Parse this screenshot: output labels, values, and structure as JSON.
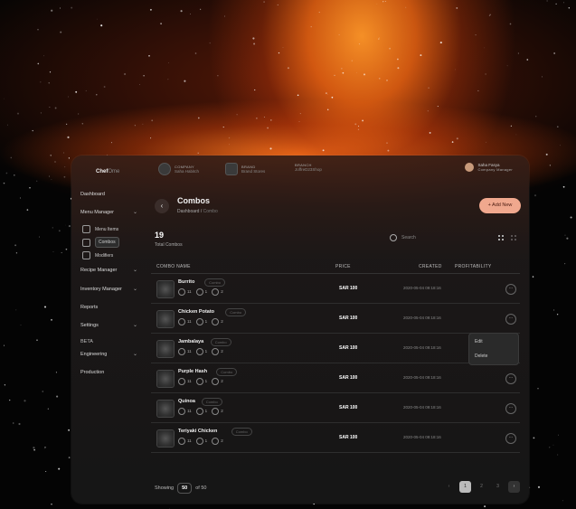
{
  "brand": {
    "logo_bold": "Chef",
    "logo_light": "Ome"
  },
  "sidebar": {
    "dashboard": "Dashboard",
    "menu_manager": "Menu Manager",
    "menu_sub": [
      "Menu Items",
      "Combos",
      "Modifiers"
    ],
    "recipe_manager": "Recipe Manager",
    "inventory_manager": "Inventory Manager",
    "reports": "Reports",
    "settings": "Settings",
    "beta": "BETA",
    "engineering": "Engineering",
    "production": "Production"
  },
  "topbar": {
    "company_label": "COMPANY",
    "company_value": "Saha Habitch",
    "brand_label": "BRAND",
    "brand_value": "Brand Stores",
    "branch_label": "BRANCH",
    "branch_value": "JoffreD23Shop",
    "user_name": "Saha Fasya",
    "user_role": "Company Manager"
  },
  "page": {
    "title": "Combos",
    "breadcrumb_root": "Dashboard",
    "breadcrumb_sep": "/",
    "breadcrumb_current": "Combo",
    "add_new": "+ Add New",
    "total_count": "19",
    "total_label": "Total Combos",
    "search_placeholder": "Search"
  },
  "table": {
    "headers": {
      "name": "COMBO NAME",
      "price": "PRICE",
      "created": "CREATED",
      "profitability": "PROFITABILITY"
    },
    "rows": [
      {
        "name": "Burrito",
        "badge": "Combo",
        "m1": "11",
        "m2": "1",
        "m3": "2",
        "price": "SAR 100",
        "created": "2020-05-04 09:18:16"
      },
      {
        "name": "Chicken Potato",
        "badge": "Combo",
        "m1": "11",
        "m2": "1",
        "m3": "2",
        "price": "SAR 100",
        "created": "2020-05-04 09:18:16"
      },
      {
        "name": "Jambalaya",
        "badge": "Combo",
        "m1": "11",
        "m2": "1",
        "m3": "2",
        "price": "SAR 100",
        "created": "2020-05-04 09:18:16"
      },
      {
        "name": "Purple Hash",
        "badge": "Combo",
        "m1": "11",
        "m2": "1",
        "m3": "2",
        "price": "SAR 100",
        "created": "2020-05-04 09:18:16"
      },
      {
        "name": "Quinoa",
        "badge": "Combo",
        "m1": "11",
        "m2": "1",
        "m3": "2",
        "price": "SAR 100",
        "created": "2020-05-04 09:18:16"
      },
      {
        "name": "Teriyaki Chicken",
        "badge": "Combo",
        "m1": "11",
        "m2": "1",
        "m3": "2",
        "price": "SAR 100",
        "created": "2020-05-04 09:18:16"
      }
    ]
  },
  "context_menu": {
    "edit": "Edit",
    "delete": "Delete"
  },
  "footer": {
    "showing": "Showing",
    "page_size": "50",
    "of_total": "of 50",
    "pages": [
      "1",
      "2",
      "3"
    ]
  },
  "colors": {
    "accent": "#f0a88e",
    "glow": "#ff8a20"
  }
}
